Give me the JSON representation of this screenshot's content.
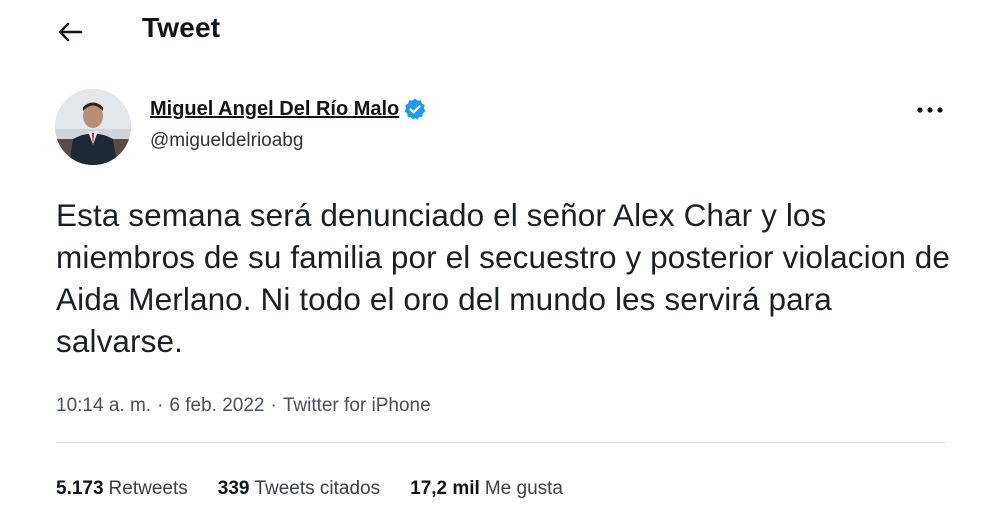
{
  "header": {
    "title": "Tweet"
  },
  "author": {
    "name": "Miguel Angel Del Río Malo",
    "handle": "@migueldelrioabg"
  },
  "tweet": {
    "text": "Esta semana será denunciado el señor Alex Char y los miembros de su familia por el secuestro y posterior violacion de Aida Merlano.  Ni todo el oro del mundo les servirá para salvarse."
  },
  "meta": {
    "time": "10:14 a. m.",
    "separator": "·",
    "date": "6 feb. 2022",
    "source": "Twitter for iPhone"
  },
  "stats": {
    "retweets_count": "5.173",
    "retweets_label": "Retweets",
    "quotes_count": "339",
    "quotes_label": "Tweets citados",
    "likes_count": "17,2 mil",
    "likes_label": "Me gusta"
  },
  "icons": {
    "back": "arrow-left-icon",
    "verified": "verified-badge-icon",
    "more": "more-horizontal-icon"
  },
  "colors": {
    "verified": "#1d9bf0",
    "text": "#0f1419",
    "secondary": "#536471",
    "divider": "#d6dbdf"
  }
}
